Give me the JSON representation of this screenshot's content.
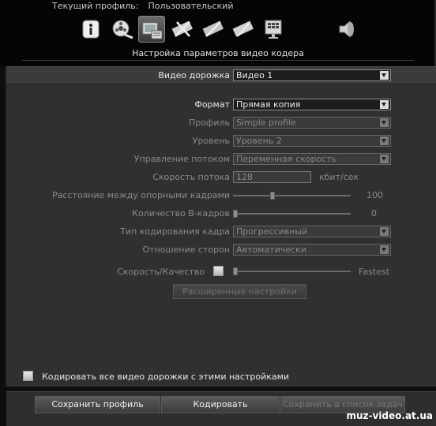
{
  "header": {
    "profile_label": "Текущий профиль:",
    "profile_value": "Пользовательский",
    "caption": "Настройка параметров видео кодера"
  },
  "toolbar": {
    "icons": [
      "info-icon",
      "audio-video-reel-icon",
      "video-settings-icon",
      "film-cut-icon",
      "film-cut-icon-2",
      "film-strip-icon",
      "monitor-grid-icon",
      "speaker-icon"
    ],
    "active_index": 2
  },
  "form": {
    "track": {
      "label": "Видео дорожка",
      "value": "Видео 1"
    },
    "format": {
      "label": "Формат",
      "value": "Прямая копия"
    },
    "profile": {
      "label": "Профиль",
      "value": "Simple profile"
    },
    "level": {
      "label": "Уровень",
      "value": "Уровень 2"
    },
    "rate_control": {
      "label": "Управление потоком",
      "value": "Переменная скорость"
    },
    "bitrate": {
      "label": "Скорость потока",
      "value": "128",
      "unit": "кбит/сек"
    },
    "keyframe_distance": {
      "label": "Расстояние между опорными кадрами",
      "value": "100",
      "slider_fraction": 0.33
    },
    "b_frames": {
      "label": "Количество B-кадров",
      "value": "0",
      "slider_fraction": 0.0
    },
    "frame_coding": {
      "label": "Тип кодирования кадра",
      "value": "Прогрессивный"
    },
    "aspect": {
      "label": "Отношение сторон",
      "value": "Автоматически"
    },
    "speed_quality": {
      "label": "Скорость/Качество",
      "value": "Fastest",
      "slider_fraction": 0.0
    },
    "advanced_button": "Расширенные настройки"
  },
  "footer": {
    "encode_all_label": "Кодировать все видео дорожки с этими настройками",
    "save_profile": "Сохранить профиль",
    "encode": "Кодировать",
    "save_to_list": "Сохранить в список задач",
    "watermark": "muz-video.at.ua"
  }
}
